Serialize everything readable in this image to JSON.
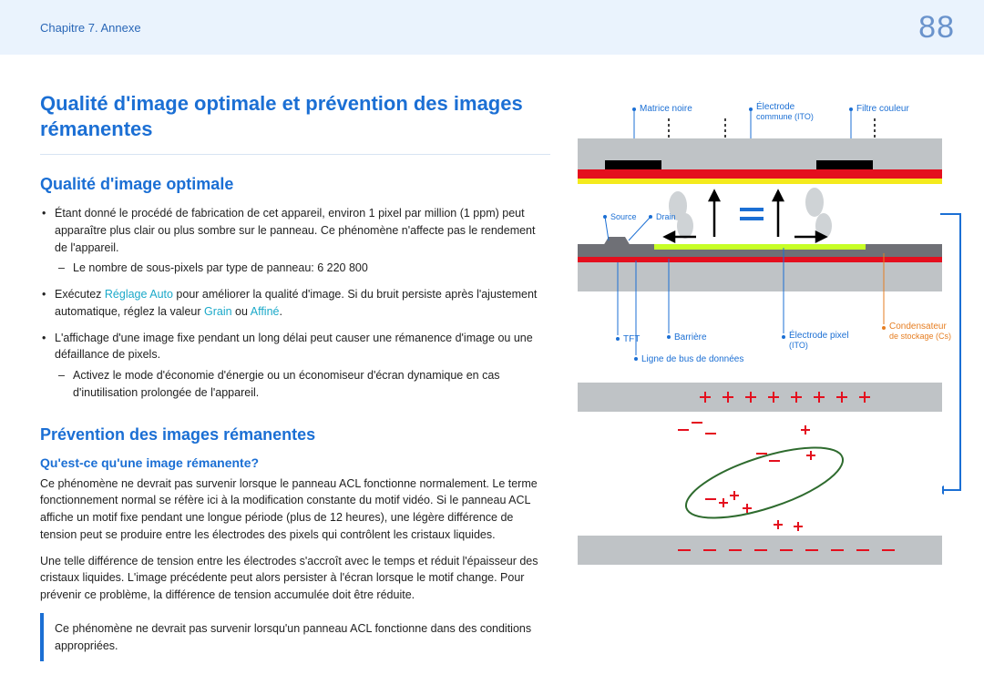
{
  "header": {
    "chapter": "Chapitre 7. Annexe",
    "page_number": "88"
  },
  "main": {
    "title": "Qualité d'image optimale et prévention des images rémanentes",
    "section_quality": {
      "heading": "Qualité d'image optimale",
      "bullets": {
        "b1_text": "Étant donné le procédé de fabrication de cet appareil, environ 1 pixel par million (1 ppm) peut apparaître plus clair ou plus sombre sur le panneau. Ce phénomène n'affecte pas le rendement de l'appareil.",
        "b1_sub": "Le nombre de sous-pixels par type de panneau: 6 220 800",
        "b2_prefix": "Exécutez ",
        "b2_link1": "Réglage Auto",
        "b2_mid": " pour améliorer la qualité d'image. Si du bruit persiste après l'ajustement automatique, réglez la valeur ",
        "b2_link2": "Grain",
        "b2_or": " ou ",
        "b2_link3": "Affiné",
        "b2_end": ".",
        "b3_text": "L'affichage d'une image fixe pendant un long délai peut causer une rémanence d'image ou une défaillance de pixels.",
        "b3_sub": "Activez le mode d'économie d'énergie ou un économiseur d'écran dynamique en cas d'inutilisation prolongée de l'appareil."
      }
    },
    "section_prevention": {
      "heading": "Prévention des images rémanentes",
      "subheading": "Qu'est-ce qu'une image rémanente?",
      "p1": "Ce phénomène ne devrait pas survenir lorsque le panneau ACL fonctionne normalement. Le terme fonctionnement normal se réfère ici à la modification constante du motif vidéo. Si le panneau ACL affiche un motif fixe pendant une longue période (plus de 12 heures), une légère différence de tension peut se produire entre les électrodes des pixels qui contrôlent les cristaux liquides.",
      "p2": "Une telle différence de tension entre les électrodes s'accroît avec le temps et réduit l'épaisseur des cristaux liquides. L'image précédente peut alors persister à l'écran lorsque le motif change. Pour prévenir ce problème, la différence de tension accumulée doit être réduite.",
      "note": "Ce phénomène ne devrait pas survenir lorsqu'un panneau ACL fonctionne dans des conditions appropriées."
    }
  },
  "diagram": {
    "labels": {
      "black_matrix": "Matrice noire",
      "common_electrode_l1": "Électrode",
      "common_electrode_l2": "commune (ITO)",
      "color_filter": "Filtre couleur",
      "source": "Source",
      "drain": "Drain",
      "tft": "TFT",
      "barrier": "Barrière",
      "pixel_electrode_l1": "Électrode pixel",
      "pixel_electrode_l2": "(ITO)",
      "storage_cap_l1": "Condensateur",
      "storage_cap_l2": "de stockage (Cs)",
      "data_bus": "Ligne de bus de données"
    }
  }
}
